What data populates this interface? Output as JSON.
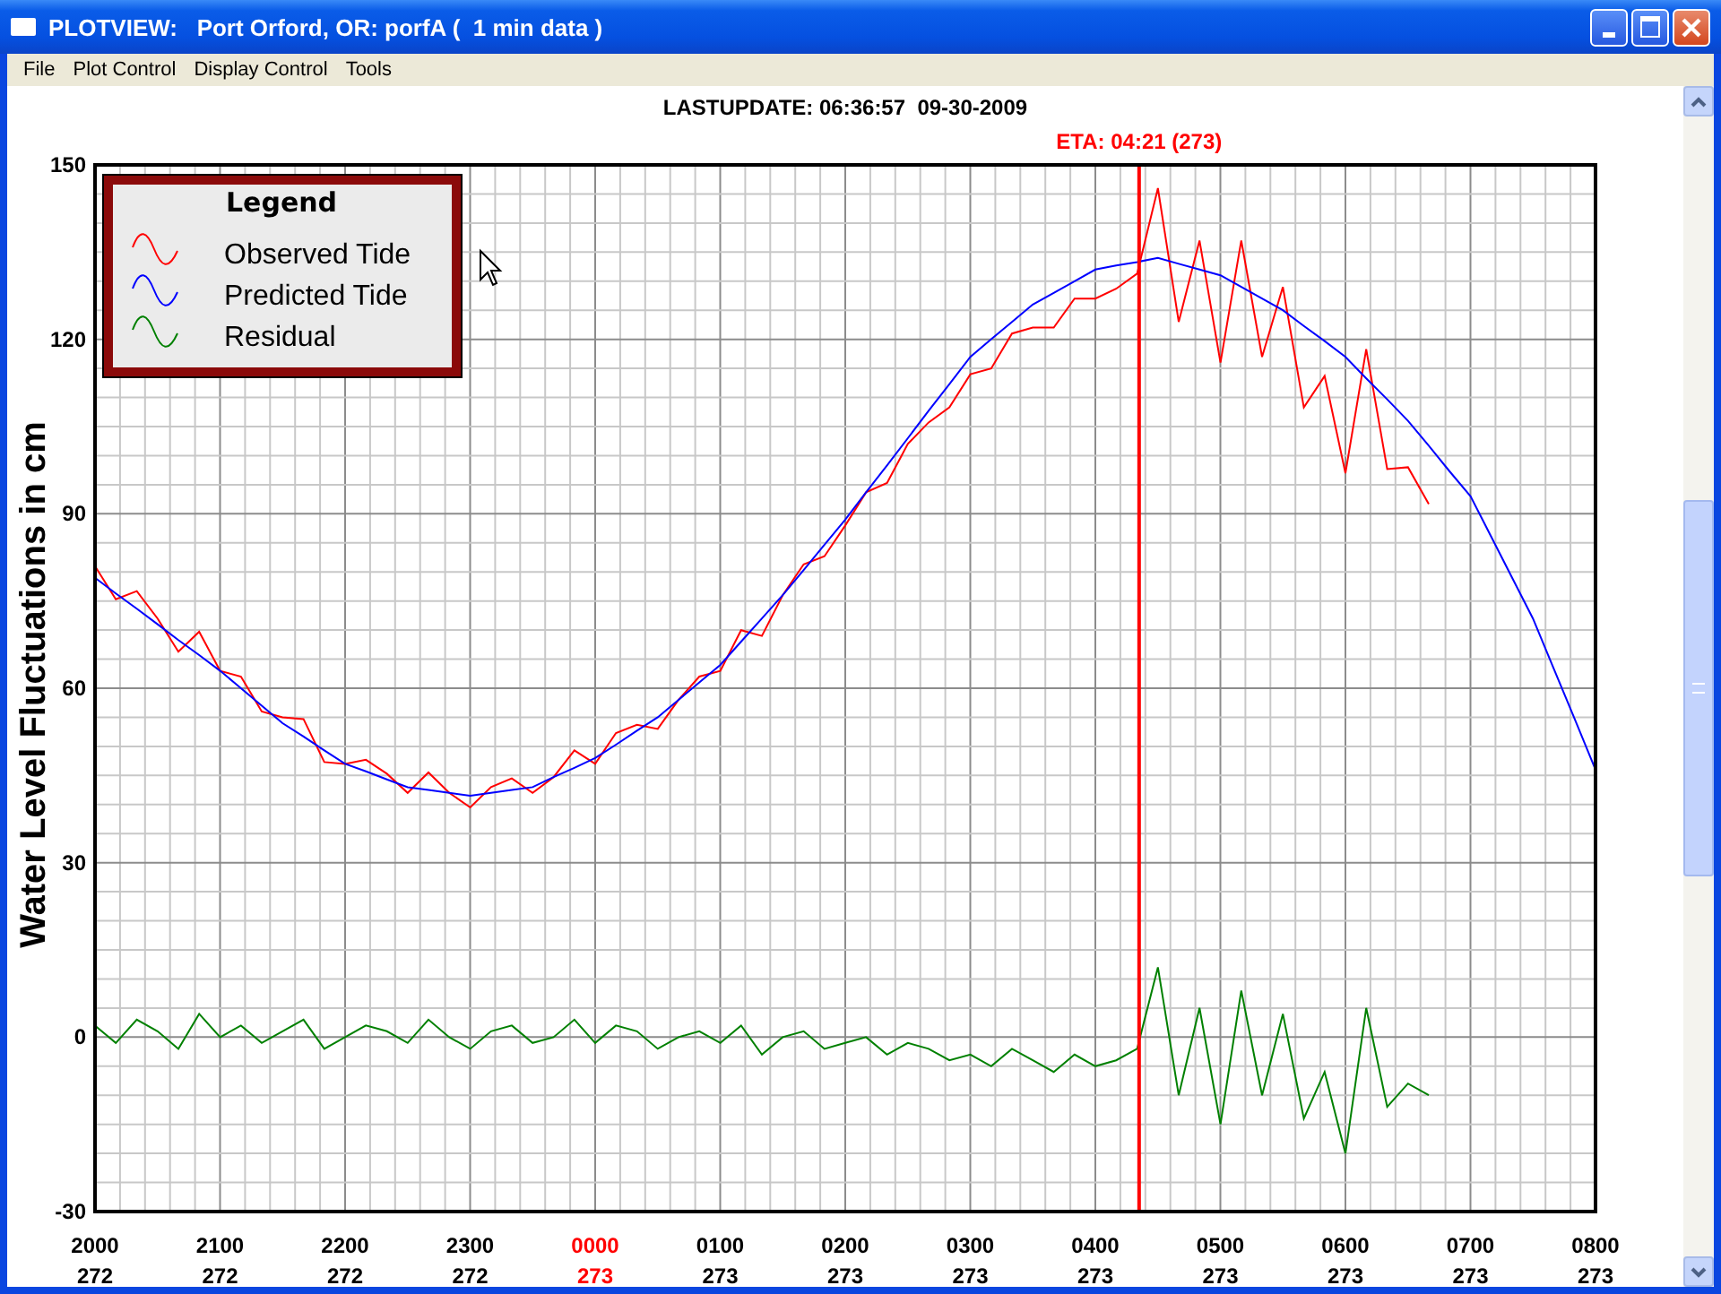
{
  "window": {
    "title": "PLOTVIEW:   Port Orford, OR: porfA (  1 min data )"
  },
  "menu": [
    "File",
    "Plot Control",
    "Display Control",
    "Tools"
  ],
  "plot": {
    "header": "LASTUPDATE: 06:36:57  09-30-2009",
    "legend_title": "Legend",
    "x_tick_days": [
      {
        "day": "272",
        "highlight": false
      },
      {
        "day": "272",
        "highlight": false
      },
      {
        "day": "272",
        "highlight": false
      },
      {
        "day": "272",
        "highlight": false
      },
      {
        "day": "273",
        "highlight": true
      },
      {
        "day": "273",
        "highlight": false
      },
      {
        "day": "273",
        "highlight": false
      },
      {
        "day": "273",
        "highlight": false
      },
      {
        "day": "273",
        "highlight": false
      },
      {
        "day": "273",
        "highlight": false
      },
      {
        "day": "273",
        "highlight": false
      },
      {
        "day": "273",
        "highlight": false
      },
      {
        "day": "273",
        "highlight": false
      }
    ],
    "chart_data": {
      "type": "line",
      "ylabel": "Water Level Fluctuations in cm",
      "categories": [
        "2000",
        null,
        null,
        null,
        null,
        null,
        "2100",
        null,
        null,
        null,
        null,
        null,
        "2200",
        null,
        null,
        null,
        null,
        null,
        "2300",
        null,
        null,
        null,
        null,
        null,
        "0000",
        null,
        null,
        null,
        null,
        null,
        "0100",
        null,
        null,
        null,
        null,
        null,
        "0200",
        null,
        null,
        null,
        null,
        null,
        "0300",
        null,
        null,
        null,
        null,
        null,
        "0400",
        null,
        null,
        null,
        null,
        null,
        "0500",
        null,
        null,
        null,
        null,
        null,
        "0600",
        null,
        null,
        null,
        null,
        null,
        "0700",
        null,
        null,
        null,
        null,
        null,
        "0800"
      ],
      "series": [
        {
          "name": "Observed Tide",
          "color": "#ff0000",
          "values": [
            81,
            75.3,
            76.7,
            72,
            66.3,
            69.7,
            63,
            62,
            56,
            55,
            54.7,
            47.3,
            47,
            47.7,
            45.3,
            42,
            45.5,
            42,
            39.5,
            43,
            44.5,
            42,
            44.7,
            49.3,
            47,
            52.3,
            53.7,
            53,
            58,
            62,
            63,
            70,
            69,
            76,
            81.3,
            82.7,
            88,
            93.7,
            95.3,
            102,
            105.7,
            108.3,
            114,
            115,
            121,
            122,
            122,
            127,
            127,
            128.7,
            131.3,
            146,
            123,
            137,
            116,
            137,
            117,
            129,
            108.3,
            113.7,
            97,
            118.3,
            97.7,
            98,
            91.7,
            null,
            null,
            null,
            null,
            null,
            null,
            null,
            null
          ]
        },
        {
          "name": "Predicted Tide",
          "color": "#0000ff",
          "values": [
            79,
            76.3,
            73.7,
            71,
            68.3,
            65.7,
            63,
            60,
            57,
            54,
            51.7,
            49.3,
            47,
            45.7,
            44.3,
            43,
            42.5,
            42,
            41.5,
            42,
            42.5,
            43,
            44.7,
            46.3,
            48,
            50.3,
            52.7,
            55,
            58,
            61,
            64,
            68,
            72,
            76,
            80.3,
            84.7,
            89,
            93.7,
            98.3,
            103,
            107.7,
            112.3,
            117,
            120,
            123,
            126,
            128,
            130,
            132,
            132.7,
            133.3,
            134,
            133,
            132,
            131,
            129,
            127,
            125,
            122.3,
            119.7,
            117,
            113.3,
            109.7,
            106,
            101.7,
            97.3,
            93,
            86,
            79,
            72,
            63.3,
            54.7,
            46
          ]
        },
        {
          "name": "Residual",
          "color": "#008000",
          "values": [
            2,
            -1,
            3,
            1,
            -2,
            4,
            0,
            2,
            -1,
            1,
            3,
            -2,
            0,
            2,
            1,
            -1,
            3,
            0,
            -2,
            1,
            2,
            -1,
            0,
            3,
            -1,
            2,
            1,
            -2,
            0,
            1,
            -1,
            2,
            -3,
            0,
            1,
            -2,
            -1,
            0,
            -3,
            -1,
            -2,
            -4,
            -3,
            -5,
            -2,
            -4,
            -6,
            -3,
            -5,
            -4,
            -2,
            12,
            -10,
            5,
            -15,
            8,
            -10,
            4,
            -14,
            -6,
            -20,
            5,
            -12,
            -8,
            -10,
            null,
            null,
            null,
            null,
            null,
            null,
            null,
            null
          ]
        }
      ],
      "ylim": [
        -30,
        150
      ],
      "yticks": [
        -30,
        0,
        30,
        60,
        90,
        120,
        150
      ],
      "grid": true,
      "legend": true,
      "annotations": [
        {
          "text": "ETA: 04:21 (273)"
        }
      ]
    }
  }
}
